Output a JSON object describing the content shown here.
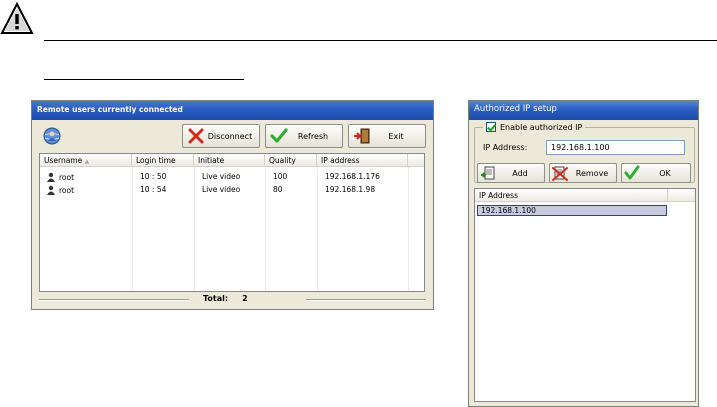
{
  "remote_window": {
    "title": "Remote users currently connected",
    "buttons": {
      "disconnect": "Disconnect",
      "refresh": "Refresh",
      "exit": "Exit"
    },
    "columns": [
      "Username",
      "Login time",
      "Initiate",
      "Quality",
      "IP address"
    ],
    "rows": [
      {
        "username": "root",
        "login_time": "10 : 50",
        "initiate": "Live video",
        "quality": "100",
        "ip": "192.168.1.176"
      },
      {
        "username": "root",
        "login_time": "10 : 54",
        "initiate": "Live video",
        "quality": "80",
        "ip": "192.168.1.98"
      }
    ],
    "status": {
      "label": "Total:",
      "count": "2"
    }
  },
  "auth_window": {
    "title": "Authorized IP setup",
    "enable_label": "Enable authorized IP",
    "enable_checked": true,
    "ip_label": "IP Address:",
    "ip_value": "192.168.1.100",
    "buttons": {
      "add": "Add",
      "remove": "Remove",
      "ok": "OK"
    },
    "list_header": "IP Address",
    "list_items": [
      "192.168.1.100"
    ]
  },
  "colors": {
    "title_bar": "#2d5fc4",
    "window_bg": "#ece9d8",
    "selection": "#c7cbe0"
  },
  "icons": [
    "warning-icon",
    "globe-user-icon",
    "disconnect-x-icon",
    "refresh-check-icon",
    "exit-door-icon",
    "user-icon",
    "add-icon",
    "remove-icon",
    "ok-check-icon"
  ]
}
